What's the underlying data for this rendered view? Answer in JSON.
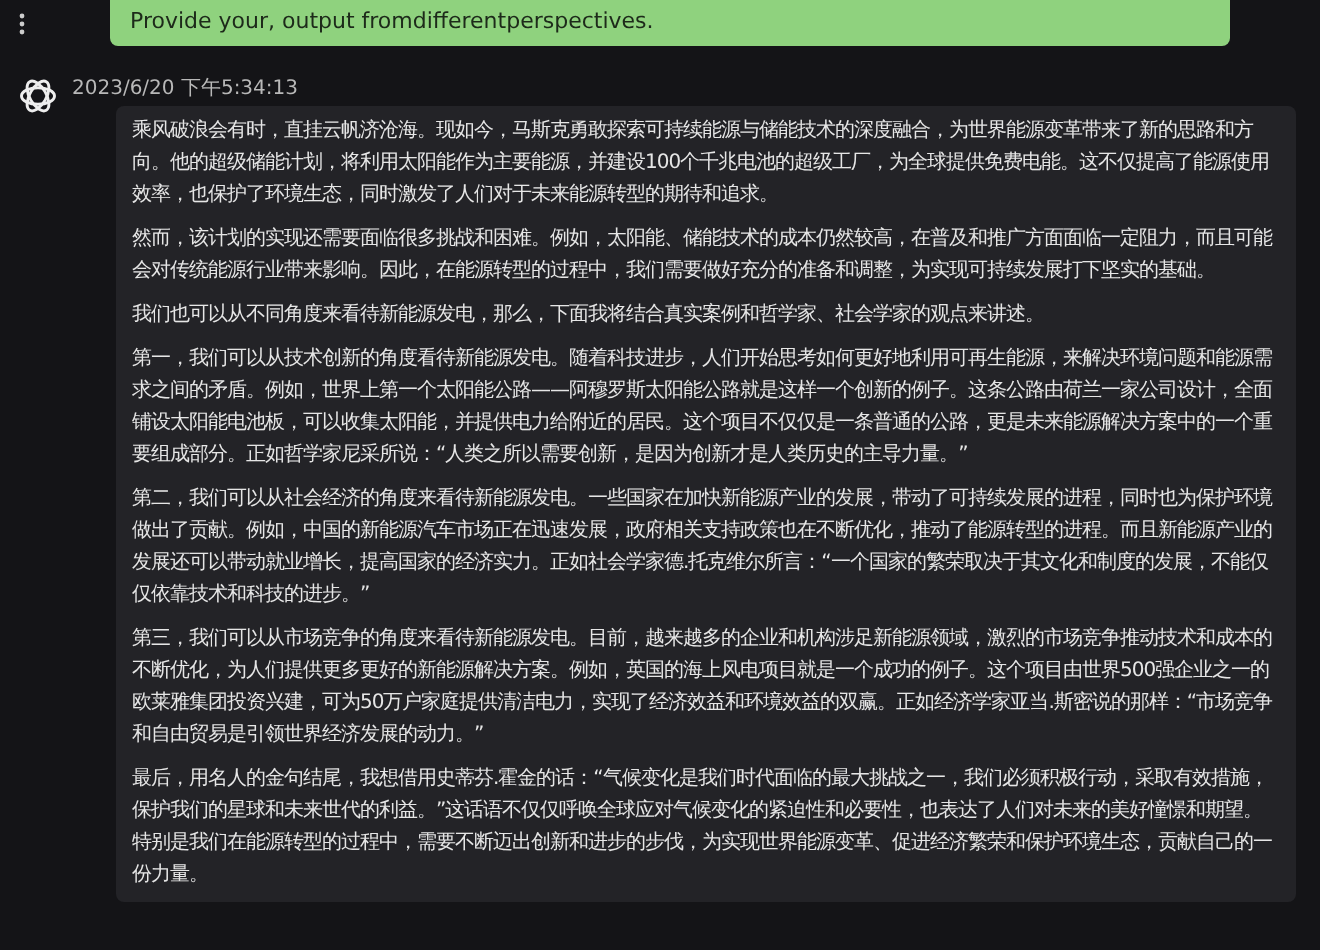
{
  "user_message": {
    "text": "Provide your, output fromdifferentperspectives."
  },
  "assistant_message": {
    "timestamp": "2023/6/20 下午5:34:13",
    "paragraphs": [
      "乘风破浪会有时，直挂云帆济沧海。现如今，马斯克勇敢探索可持续能源与储能技术的深度融合，为世界能源变革带来了新的思路和方向。他的超级储能计划，将利用太阳能作为主要能源，并建设100个千兆电池的超级工厂，为全球提供免费电能。这不仅提高了能源使用效率，也保护了环境生态，同时激发了人们对于未来能源转型的期待和追求。",
      "然而，该计划的实现还需要面临很多挑战和困难。例如，太阳能、储能技术的成本仍然较高，在普及和推广方面面临一定阻力，而且可能会对传统能源行业带来影响。因此，在能源转型的过程中，我们需要做好充分的准备和调整，为实现可持续发展打下坚实的基础。",
      "我们也可以从不同角度来看待新能源发电，那么，下面我将结合真实案例和哲学家、社会学家的观点来讲述。",
      "第一，我们可以从技术创新的角度看待新能源发电。随着科技进步，人们开始思考如何更好地利用可再生能源，来解决环境问题和能源需求之间的矛盾。例如，世界上第一个太阳能公路——阿穆罗斯太阳能公路就是这样一个创新的例子。这条公路由荷兰一家公司设计，全面铺设太阳能电池板，可以收集太阳能，并提供电力给附近的居民。这个项目不仅仅是一条普通的公路，更是未来能源解决方案中的一个重要组成部分。正如哲学家尼采所说：“人类之所以需要创新，是因为创新才是人类历史的主导力量。”",
      "第二，我们可以从社会经济的角度来看待新能源发电。一些国家在加快新能源产业的发展，带动了可持续发展的进程，同时也为保护环境做出了贡献。例如，中国的新能源汽车市场正在迅速发展，政府相关支持政策也在不断优化，推动了能源转型的进程。而且新能源产业的发展还可以带动就业增长，提高国家的经济实力。正如社会学家德.托克维尔所言：“一个国家的繁荣取决于其文化和制度的发展，不能仅仅依靠技术和科技的进步。”",
      "第三，我们可以从市场竞争的角度来看待新能源发电。目前，越来越多的企业和机构涉足新能源领域，激烈的市场竞争推动技术和成本的不断优化，为人们提供更多更好的新能源解决方案。例如，英国的海上风电项目就是一个成功的例子。这个项目由世界500强企业之一的欧莱雅集团投资兴建，可为50万户家庭提供清洁电力，实现了经济效益和环境效益的双赢。正如经济学家亚当.斯密说的那样：“市场竞争和自由贸易是引领世界经济发展的动力。”",
      "最后，用名人的金句结尾，我想借用史蒂芬.霍金的话：“气候变化是我们时代面临的最大挑战之一，我们必须积极行动，采取有效措施，保护我们的星球和未来世代的利益。”这话语不仅仅呼唤全球应对气候变化的紧迫性和必要性，也表达了人们对未来的美好憧憬和期望。特别是我们在能源转型的过程中，需要不断迈出创新和进步的步伐，为实现世界能源变革、促进经济繁荣和保护环境生态，贡献自己的一份力量。"
    ]
  }
}
